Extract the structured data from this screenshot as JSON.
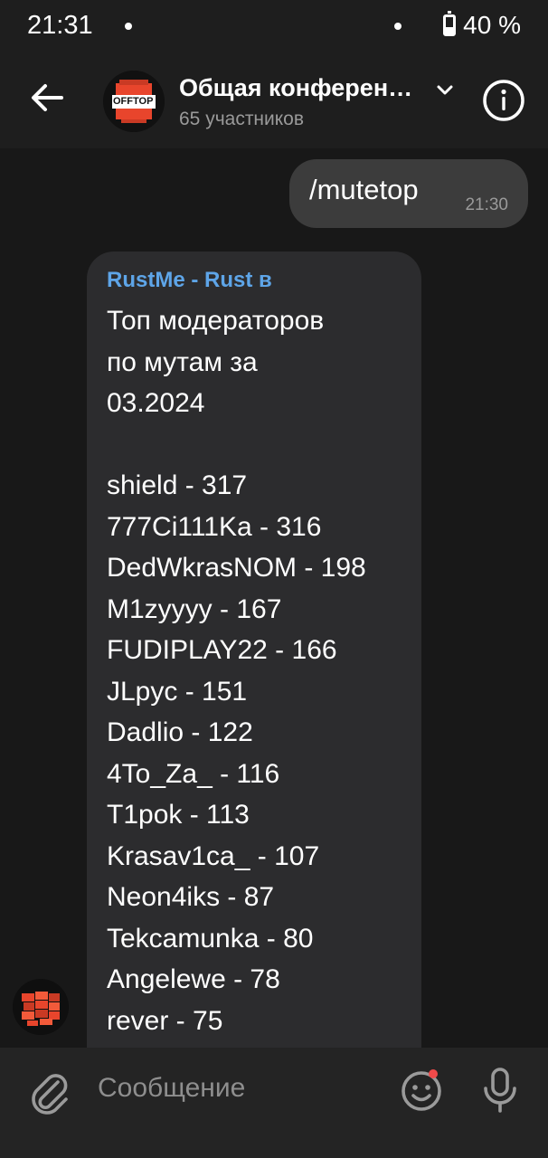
{
  "status_bar": {
    "time": "21:31",
    "battery_percent": "40 %"
  },
  "header": {
    "title": "Общая конферен…",
    "subtitle": "65 участников",
    "avatar_text": "OFFTOP",
    "back_icon": "arrow-left-icon",
    "dropdown_icon": "chevron-down-icon",
    "info_icon": "info-icon"
  },
  "messages": {
    "outgoing": {
      "text": "/mutetop",
      "time": "21:30"
    },
    "incoming": {
      "sender": "RustMe - Rust в",
      "lines": [
        "Топ модераторов",
        "по мутам за",
        "03.2024",
        "",
        "shield - 317",
        "777Ci111Ka - 316",
        "DedWkrasNOM - 198",
        "M1zyyyy - 167",
        "FUDIPLAY22 - 166",
        "JLpyc - 151",
        "Dadlio - 122",
        "4To_Za_ - 116",
        "T1pok - 113",
        "Krasav1ca_ - 107",
        "Neon4iks - 87",
        "Tekcamunka - 80",
        "Angelewe - 78",
        "rever - 75"
      ]
    }
  },
  "input": {
    "placeholder": "Сообщение",
    "attach_icon": "paperclip-icon",
    "emoji_icon": "emoji-icon",
    "mic_icon": "microphone-icon"
  },
  "colors": {
    "background": "#181818",
    "header": "#1e1e1e",
    "incoming_bubble": "#2c2c2e",
    "outgoing_bubble": "#3c3c3c",
    "sender_name": "#5ea5e8",
    "badge": "#f04a4a"
  }
}
